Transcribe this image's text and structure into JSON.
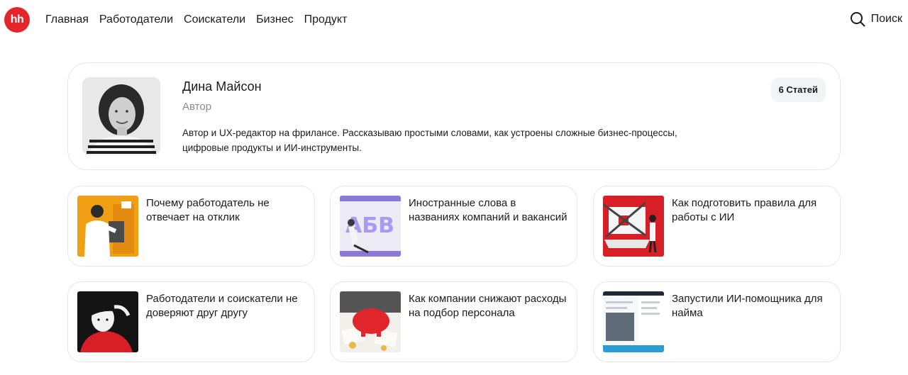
{
  "header": {
    "logo_text": "hh",
    "nav": [
      "Главная",
      "Работодатели",
      "Соискатели",
      "Бизнес",
      "Продукт"
    ],
    "search_label": "Поиск"
  },
  "author": {
    "name": "Дина Майсон",
    "role": "Автор",
    "bio": "Автор и UX-редактор на фрилансе. Рассказываю простыми словами, как устроены сложные бизнес-процессы, цифровые продукты и ИИ-инструменты.",
    "articles_badge": "6 Статей"
  },
  "articles": [
    {
      "title": "Почему работодатель не отвечает на отклик",
      "thumb_icon": "man-at-mailbox-illustration"
    },
    {
      "title": "Иностранные слова в названиях компаний и вакансий",
      "thumb_icon": "cyrillic-letters-illustration"
    },
    {
      "title": "Как подготовить правила для работы с ИИ",
      "thumb_icon": "chained-laptop-illustration"
    },
    {
      "title": "Работодатели и соискатели не доверяют друг другу",
      "thumb_icon": "distrustful-man-illustration"
    },
    {
      "title": "Как компании снижают расходы на подбор персонала",
      "thumb_icon": "piggy-bank-illustration"
    },
    {
      "title": "Запустили ИИ-помощника для найма",
      "thumb_icon": "ai-assistant-screenshot"
    }
  ],
  "colors": {
    "brand": "#e3262a",
    "card_border": "#e6e6e6",
    "muted_text": "#8a8a8a",
    "badge_bg": "#f2f3f5"
  }
}
